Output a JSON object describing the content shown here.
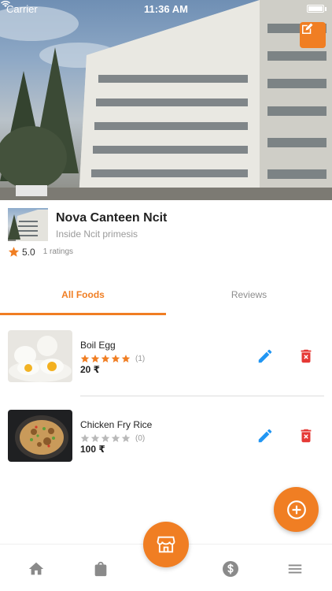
{
  "status_bar": {
    "carrier": "Carrier",
    "time": "11:36 AM"
  },
  "store": {
    "name": "Nova Canteen Ncit",
    "subtitle": "Inside Ncit primesis",
    "rating": "5.0",
    "ratings_count": "1 ratings"
  },
  "tabs": [
    {
      "label": "All Foods",
      "active": true
    },
    {
      "label": "Reviews",
      "active": false
    }
  ],
  "foods": [
    {
      "name": "Boil Egg",
      "rating": 5,
      "reviews": "(1)",
      "price": "20 ₹"
    },
    {
      "name": "Chicken Fry Rice",
      "rating": 0,
      "reviews": "(0)",
      "price": "100 ₹"
    }
  ],
  "colors": {
    "accent": "#f07e23",
    "edit_blue": "#2196f3",
    "delete_red": "#e53935",
    "nav_icon_gray": "#8a8a8a"
  },
  "icons": {
    "edit_banner": "edit-square-icon",
    "edit_food": "pencil-icon",
    "delete_food": "trash-icon",
    "add": "add-circle-icon",
    "nav": [
      "home-icon",
      "shopping-bag-icon",
      "store-icon",
      "dollar-icon",
      "menu-icon"
    ]
  }
}
